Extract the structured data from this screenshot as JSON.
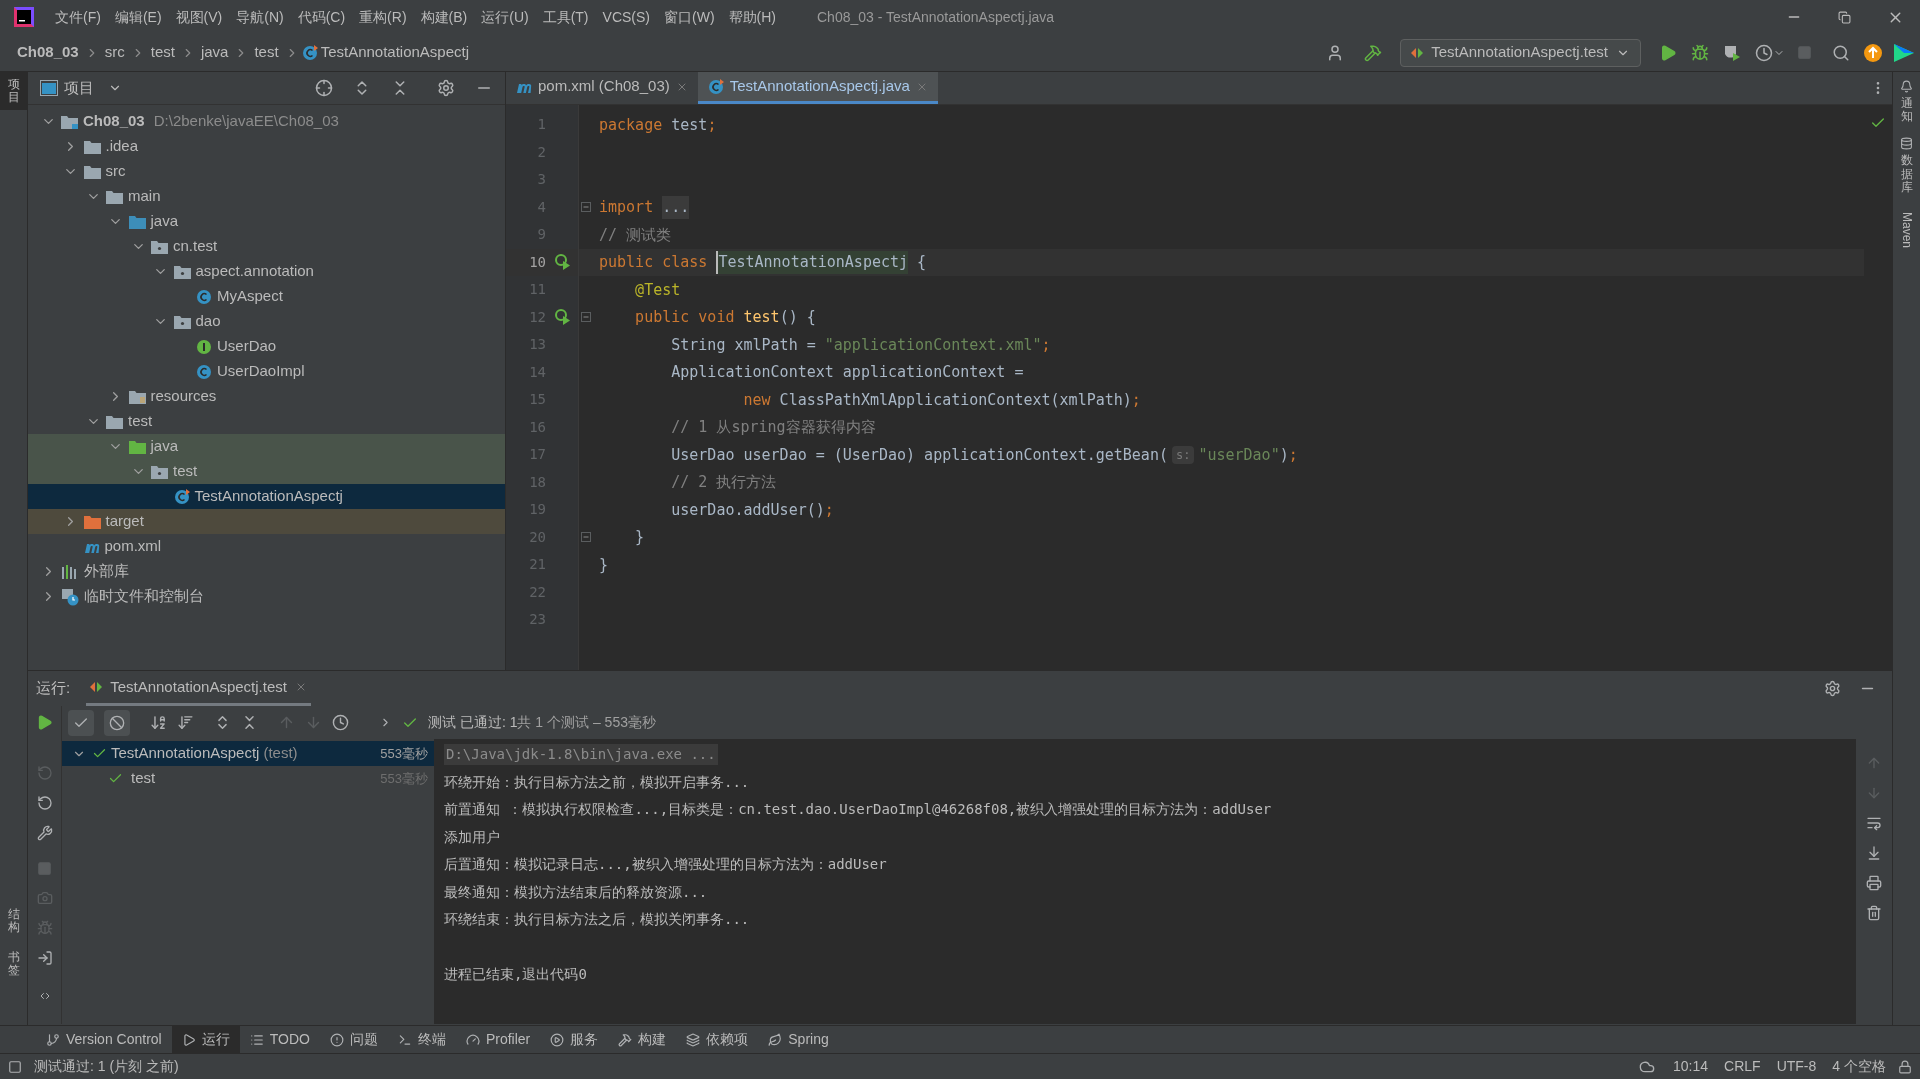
{
  "menu": [
    "文件(F)",
    "编辑(E)",
    "视图(V)",
    "导航(N)",
    "代码(C)",
    "重构(R)",
    "构建(B)",
    "运行(U)",
    "工具(T)",
    "VCS(S)",
    "窗口(W)",
    "帮助(H)"
  ],
  "window": {
    "title": "Ch08_03 - TestAnnotationAspectj.java"
  },
  "breadcrumbs": [
    "Ch08_03",
    "src",
    "test",
    "java",
    "test",
    "TestAnnotationAspectj"
  ],
  "run_config": {
    "label": "TestAnnotationAspectj.test"
  },
  "left_stripe": {
    "top": [
      {
        "label": "项目",
        "selected": true
      }
    ],
    "bottom": [
      {
        "label": "结构",
        "selected": false
      },
      {
        "label": "书签",
        "selected": false
      }
    ]
  },
  "right_stripe": [
    {
      "label": "通知",
      "kind": "cjk"
    },
    {
      "label": "数据库",
      "kind": "cjk"
    },
    {
      "label": "Maven",
      "kind": "latin"
    }
  ],
  "project_panel": {
    "title": "项目",
    "tree": [
      {
        "label": "Ch08_03",
        "path": "D:\\2benke\\javaEE\\Ch08_03",
        "kind": "module",
        "expanded": true,
        "selected": false,
        "children": [
          {
            "label": ".idea",
            "kind": "folder",
            "expanded": false,
            "selected": false
          },
          {
            "label": "src",
            "kind": "folder",
            "expanded": true,
            "selected": false,
            "children": [
              {
                "label": "main",
                "kind": "folder",
                "expanded": true,
                "selected": false,
                "children": [
                  {
                    "label": "java",
                    "kind": "source_root",
                    "expanded": true,
                    "selected": false,
                    "children": [
                      {
                        "label": "cn.test",
                        "kind": "package",
                        "expanded": true,
                        "selected": false,
                        "children": [
                          {
                            "label": "aspect.annotation",
                            "kind": "package",
                            "expanded": true,
                            "selected": false,
                            "children": [
                              {
                                "label": "MyAspect",
                                "kind": "class",
                                "selected": false
                              }
                            ]
                          },
                          {
                            "label": "dao",
                            "kind": "package",
                            "expanded": true,
                            "selected": false,
                            "children": [
                              {
                                "label": "UserDao",
                                "kind": "interface",
                                "selected": false
                              },
                              {
                                "label": "UserDaoImpl",
                                "kind": "class",
                                "selected": false
                              }
                            ]
                          }
                        ]
                      }
                    ]
                  },
                  {
                    "label": "resources",
                    "kind": "resources",
                    "expanded": false,
                    "selected": false
                  }
                ]
              },
              {
                "label": "test",
                "kind": "folder",
                "expanded": true,
                "selected": false,
                "children": [
                  {
                    "label": "java",
                    "kind": "test_root",
                    "expanded": true,
                    "selected": false,
                    "children": [
                      {
                        "label": "test",
                        "kind": "package",
                        "expanded": true,
                        "selected": false,
                        "children": [
                          {
                            "label": "TestAnnotationAspectj",
                            "kind": "test_class",
                            "selected": true
                          }
                        ]
                      }
                    ]
                  }
                ]
              }
            ]
          },
          {
            "label": "target",
            "kind": "excluded",
            "expanded": false,
            "selected": false
          },
          {
            "label": "pom.xml",
            "kind": "maven",
            "selected": false
          }
        ]
      },
      {
        "label": "外部库",
        "kind": "library",
        "expanded": false,
        "selected": false
      },
      {
        "label": "临时文件和控制台",
        "kind": "scratch",
        "expanded": false,
        "selected": false
      }
    ]
  },
  "editor": {
    "tabs": [
      {
        "label": "pom.xml (Ch08_03)",
        "kind": "maven",
        "selected": false
      },
      {
        "label": "TestAnnotationAspectj.java",
        "kind": "test_class",
        "selected": true
      }
    ],
    "lines": [
      {
        "number": "1",
        "tokens": [
          {
            "text": "package",
            "kind": "kw"
          },
          {
            "text": " test",
            "kind": "plain"
          },
          {
            "text": ";",
            "kind": "kw"
          }
        ]
      },
      {
        "number": "2"
      },
      {
        "number": "3"
      },
      {
        "number": "4",
        "fold": true,
        "tokens": [
          {
            "text": "import ",
            "kind": "kw"
          },
          {
            "text": "...",
            "kind": "folded"
          }
        ]
      },
      {
        "number": "9",
        "tokens": [
          {
            "text": "// 测试类",
            "kind": "comment"
          }
        ]
      },
      {
        "number": "10",
        "run": true,
        "current": true,
        "tokens": [
          {
            "text": "public class ",
            "kind": "kw"
          },
          {
            "text": "TestAnnotationAspectj",
            "kind": "highlighted",
            "caret": true
          },
          {
            "text": " {",
            "kind": "plain"
          }
        ]
      },
      {
        "number": "11",
        "tokens": [
          {
            "text": "    @Test",
            "kind": "ann"
          }
        ]
      },
      {
        "number": "12",
        "run": true,
        "fold": true,
        "tokens": [
          {
            "text": "    public void ",
            "kind": "kw"
          },
          {
            "text": "test",
            "kind": "method"
          },
          {
            "text": "() {",
            "kind": "plain"
          }
        ]
      },
      {
        "number": "13",
        "tokens": [
          {
            "text": "        String xmlPath = ",
            "kind": "plain"
          },
          {
            "text": "\"applicationContext.xml\"",
            "kind": "str"
          },
          {
            "text": ";",
            "kind": "kw"
          }
        ]
      },
      {
        "number": "14",
        "tokens": [
          {
            "text": "        ApplicationContext applicationContext =",
            "kind": "plain"
          }
        ]
      },
      {
        "number": "15",
        "tokens": [
          {
            "text": "                new",
            "kind": "kw"
          },
          {
            "text": " ClassPathXmlApplicationContext(xmlPath)",
            "kind": "plain"
          },
          {
            "text": ";",
            "kind": "kw"
          }
        ]
      },
      {
        "number": "16",
        "tokens": [
          {
            "text": "        // 1 从spring容器获得内容",
            "kind": "comment"
          }
        ]
      },
      {
        "number": "17",
        "tokens": [
          {
            "text": "        UserDao userDao = (UserDao) applicationContext.getBean(",
            "kind": "plain"
          },
          {
            "text": "s:",
            "kind": "hint"
          },
          {
            "text": "\"userDao\"",
            "kind": "str"
          },
          {
            "text": ")",
            "kind": "plain"
          },
          {
            "text": ";",
            "kind": "kw"
          }
        ]
      },
      {
        "number": "18",
        "tokens": [
          {
            "text": "        // 2 执行方法",
            "kind": "comment"
          }
        ]
      },
      {
        "number": "19",
        "tokens": [
          {
            "text": "        userDao.addUser()",
            "kind": "plain"
          },
          {
            "text": ";",
            "kind": "kw"
          }
        ]
      },
      {
        "number": "20",
        "fold": true,
        "tokens": [
          {
            "text": "    }",
            "kind": "plain"
          }
        ]
      },
      {
        "number": "21",
        "tokens": [
          {
            "text": "}",
            "kind": "plain"
          }
        ]
      },
      {
        "number": "22"
      },
      {
        "number": "23"
      }
    ]
  },
  "run_panel": {
    "label": "运行:",
    "tab": "TestAnnotationAspectj.test",
    "filters": [
      {
        "kind": "passed",
        "selected": true
      },
      {
        "kind": "ignored",
        "selected": true
      }
    ],
    "summary": "测试 已通过: 1",
    "summary_detail": "共 1 个测试 – 553毫秒",
    "results": [
      {
        "name": "TestAnnotationAspectj",
        "suffix": "(test)",
        "time": "553毫秒",
        "passed": true,
        "selected": true,
        "expanded": true,
        "children": [
          {
            "name": "test",
            "time": "553毫秒",
            "passed": true,
            "selected": false
          }
        ]
      }
    ],
    "console": [
      {
        "kind": "command",
        "text": "D:\\Java\\jdk-1.8\\bin\\java.exe ..."
      },
      {
        "kind": "output",
        "text": "环绕开始：执行目标方法之前，模拟开启事务..."
      },
      {
        "kind": "output",
        "text": "前置通知 ：模拟执行权限检查...,目标类是：cn.test.dao.UserDaoImpl@46268f08,被织入增强处理的目标方法为：addUser"
      },
      {
        "kind": "output",
        "text": "添加用户"
      },
      {
        "kind": "output",
        "text": "后置通知：模拟记录日志...,被织入增强处理的目标方法为：addUser"
      },
      {
        "kind": "output",
        "text": "最终通知：模拟方法结束后的释放资源..."
      },
      {
        "kind": "output",
        "text": "环绕结束：执行目标方法之后，模拟关闭事务..."
      },
      {
        "kind": "gap"
      },
      {
        "kind": "output",
        "text": "进程已结束,退出代码0"
      }
    ]
  },
  "tool_tabs": [
    {
      "label": "Version Control",
      "kind": "vcs",
      "selected": false
    },
    {
      "label": "运行",
      "kind": "run",
      "selected": true
    },
    {
      "label": "TODO",
      "kind": "todo",
      "selected": false
    },
    {
      "label": "问题",
      "kind": "problems",
      "selected": false
    },
    {
      "label": "终端",
      "kind": "terminal",
      "selected": false
    },
    {
      "label": "Profiler",
      "kind": "profiler",
      "selected": false
    },
    {
      "label": "服务",
      "kind": "services",
      "selected": false
    },
    {
      "label": "构建",
      "kind": "build",
      "selected": false
    },
    {
      "label": "依赖项",
      "kind": "deps",
      "selected": false
    },
    {
      "label": "Spring",
      "kind": "spring",
      "selected": false
    }
  ],
  "status_bar": {
    "message": "测试通过: 1 (片刻 之前)",
    "items": [
      "10:14",
      "CRLF",
      "UTF-8",
      "4 个空格"
    ]
  }
}
